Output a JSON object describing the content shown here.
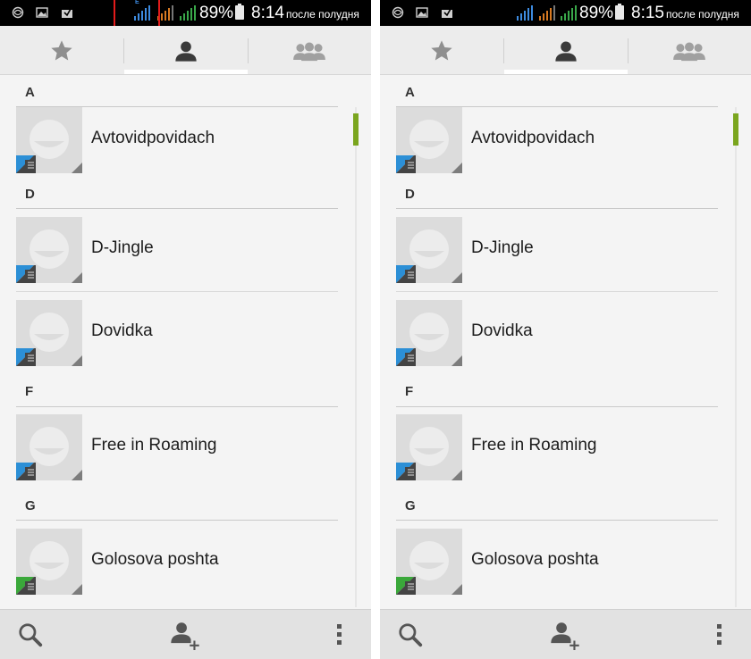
{
  "screens": [
    {
      "status_bar": {
        "battery": "89%",
        "time": "8:14",
        "ampm": "после полудня",
        "network_type": "E"
      },
      "annotation": {
        "color": "#e21b1b"
      },
      "tabs": [
        {
          "icon": "star-icon"
        },
        {
          "icon": "person-icon",
          "selected": true
        },
        {
          "icon": "group-icon"
        }
      ],
      "sections": [
        {
          "letter": "A",
          "contacts": [
            {
              "name": "Avtovidpovidach",
              "sim_color": "#2c8fd6"
            }
          ]
        },
        {
          "letter": "D",
          "contacts": [
            {
              "name": "D-Jingle",
              "sim_color": "#2c8fd6"
            },
            {
              "name": "Dovidka",
              "sim_color": "#2c8fd6"
            }
          ]
        },
        {
          "letter": "F",
          "contacts": [
            {
              "name": "Free in Roaming",
              "sim_color": "#2c8fd6"
            }
          ]
        },
        {
          "letter": "G",
          "contacts": [
            {
              "name": "Golosova poshta",
              "sim_color": "#3aa83a"
            }
          ]
        }
      ],
      "scrollbar_color": "#7aa51e"
    },
    {
      "status_bar": {
        "battery": "89%",
        "time": "8:15",
        "ampm": "после полудня"
      },
      "tabs": [
        {
          "icon": "star-icon"
        },
        {
          "icon": "person-icon",
          "selected": true
        },
        {
          "icon": "group-icon"
        }
      ],
      "sections": [
        {
          "letter": "A",
          "contacts": [
            {
              "name": "Avtovidpovidach",
              "sim_color": "#2c8fd6"
            }
          ]
        },
        {
          "letter": "D",
          "contacts": [
            {
              "name": "D-Jingle",
              "sim_color": "#2c8fd6"
            },
            {
              "name": "Dovidka",
              "sim_color": "#2c8fd6"
            }
          ]
        },
        {
          "letter": "F",
          "contacts": [
            {
              "name": "Free in Roaming",
              "sim_color": "#2c8fd6"
            }
          ]
        },
        {
          "letter": "G",
          "contacts": [
            {
              "name": "Golosova poshta",
              "sim_color": "#3aa83a"
            }
          ]
        }
      ],
      "scrollbar_color": "#7aa51e"
    }
  ]
}
